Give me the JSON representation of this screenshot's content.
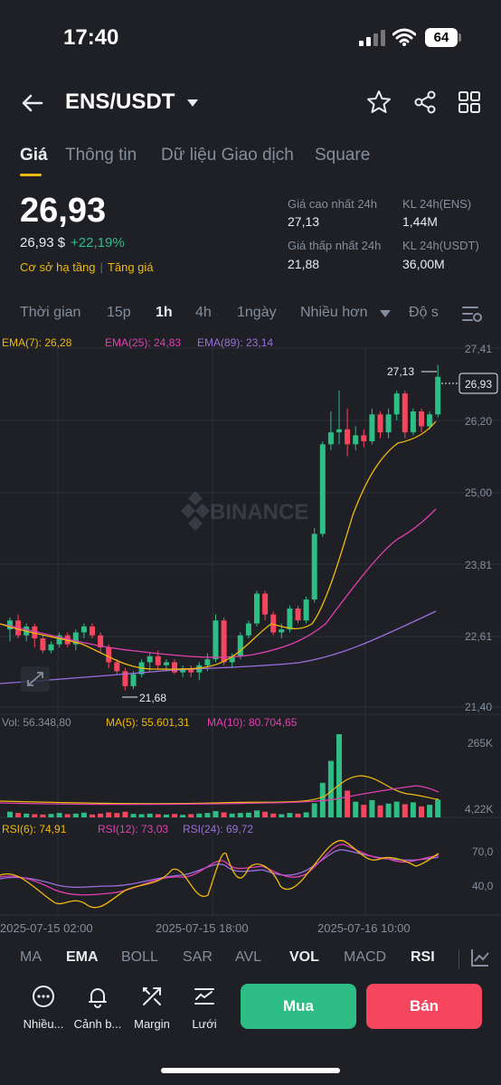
{
  "status": {
    "time": "17:40",
    "battery": "64"
  },
  "header": {
    "pair": "ENS/USDT"
  },
  "tabs": [
    {
      "label": "Giá",
      "active": true
    },
    {
      "label": "Thông tin"
    },
    {
      "label": "Dữ liệu Giao dịch"
    },
    {
      "label": "Square"
    }
  ],
  "price": {
    "last": "26,93",
    "usd": "26,93 $",
    "change": "+22,19%",
    "tag1": "Cơ sở hạ tầng",
    "tag2": "Tăng giá"
  },
  "stats": {
    "high_label": "Giá cao nhất 24h",
    "high_value": "27,13",
    "vol_ens_label": "KL 24h(ENS)",
    "vol_ens_value": "1,44M",
    "low_label": "Giá thấp nhất 24h",
    "low_value": "21,88",
    "vol_usdt_label": "KL 24h(USDT)",
    "vol_usdt_value": "36,00M"
  },
  "intervals": [
    "Thời gian",
    "15p",
    "1h",
    "4h",
    "1ngày",
    "Nhiều hơn",
    "Độ s"
  ],
  "active_interval": "1h",
  "ema_legend": {
    "ema7": "EMA(7): 26,28",
    "ema25": "EMA(25): 24,83",
    "ema89": "EMA(89): 23,14"
  },
  "price_axis": [
    "27,41",
    "26,20",
    "25,00",
    "23,81",
    "22,61",
    "21,40"
  ],
  "last_price_tag": "26,93",
  "high_marker": "27,13",
  "low_marker": "21,68",
  "watermark": "BINANCE",
  "vol_legend": {
    "vol": "Vol: 56.348,80",
    "ma5": "MA(5): 55.601,31",
    "ma10": "MA(10): 80.704,65"
  },
  "vol_axis": [
    "265K",
    "4,22K"
  ],
  "rsi_legend": {
    "rsi6": "RSI(6): 74,91",
    "rsi12": "RSI(12): 73,03",
    "rsi24": "RSI(24): 69,72"
  },
  "rsi_axis": [
    "70,0",
    "40,0"
  ],
  "time_axis": [
    "2025-07-15 02:00",
    "2025-07-15 18:00",
    "2025-07-16 10:00"
  ],
  "indicator_tabs": [
    "MA",
    "EMA",
    "BOLL",
    "SAR",
    "AVL",
    "VOL",
    "MACD",
    "RSI"
  ],
  "actions": {
    "more": "Nhiều...",
    "alert": "Cảnh b...",
    "margin": "Margin",
    "grid": "Lưới"
  },
  "buttons": {
    "buy": "Mua",
    "sell": "Bán"
  },
  "colors": {
    "up": "#2ebd85",
    "down": "#f6465d",
    "accent": "#f0b90b",
    "ema25": "#e040b0",
    "ema89": "#9b6fe0"
  },
  "chart_data": {
    "type": "candlestick",
    "ylim": [
      21.4,
      27.41
    ],
    "candles": [
      [
        22.7,
        22.85,
        22.5,
        22.9
      ],
      [
        22.85,
        22.6,
        22.55,
        22.95
      ],
      [
        22.6,
        22.75,
        22.5,
        22.8
      ],
      [
        22.75,
        22.55,
        22.4,
        22.8
      ],
      [
        22.55,
        22.35,
        22.3,
        22.6
      ],
      [
        22.35,
        22.45,
        22.3,
        22.5
      ],
      [
        22.45,
        22.6,
        22.4,
        22.65
      ],
      [
        22.6,
        22.45,
        22.4,
        22.65
      ],
      [
        22.45,
        22.65,
        22.35,
        22.7
      ],
      [
        22.65,
        22.75,
        22.55,
        22.8
      ],
      [
        22.75,
        22.6,
        22.55,
        22.8
      ],
      [
        22.6,
        22.4,
        22.3,
        22.65
      ],
      [
        22.4,
        22.15,
        22.05,
        22.45
      ],
      [
        22.15,
        22.0,
        21.95,
        22.2
      ],
      [
        22.0,
        21.75,
        21.68,
        22.05
      ],
      [
        21.75,
        21.95,
        21.7,
        22.0
      ],
      [
        21.95,
        22.15,
        21.9,
        22.2
      ],
      [
        22.15,
        22.25,
        22.0,
        22.3
      ],
      [
        22.25,
        22.1,
        22.05,
        22.35
      ],
      [
        22.1,
        22.15,
        22.0,
        22.2
      ],
      [
        22.15,
        21.98,
        21.95,
        22.2
      ],
      [
        21.98,
        22.05,
        21.9,
        22.1
      ],
      [
        22.05,
        21.98,
        21.9,
        22.1
      ],
      [
        21.98,
        22.1,
        21.85,
        22.15
      ],
      [
        22.1,
        22.2,
        22.0,
        22.3
      ],
      [
        22.2,
        22.85,
        22.15,
        22.95
      ],
      [
        22.85,
        22.15,
        22.1,
        22.9
      ],
      [
        22.15,
        22.25,
        22.05,
        22.3
      ],
      [
        22.25,
        22.6,
        22.2,
        22.65
      ],
      [
        22.6,
        22.8,
        22.55,
        22.85
      ],
      [
        22.8,
        23.3,
        22.75,
        23.35
      ],
      [
        23.3,
        22.95,
        22.85,
        23.35
      ],
      [
        22.95,
        22.65,
        22.6,
        23.0
      ],
      [
        22.65,
        22.7,
        22.55,
        22.8
      ],
      [
        22.7,
        23.05,
        22.65,
        23.1
      ],
      [
        23.05,
        22.85,
        22.8,
        23.1
      ],
      [
        22.85,
        23.2,
        22.8,
        23.25
      ],
      [
        23.2,
        24.3,
        23.15,
        24.4
      ],
      [
        24.3,
        25.8,
        24.25,
        25.85
      ],
      [
        25.8,
        26.0,
        25.7,
        26.35
      ],
      [
        26.0,
        26.05,
        25.8,
        26.7
      ],
      [
        26.05,
        25.8,
        25.6,
        26.4
      ],
      [
        25.8,
        25.95,
        25.7,
        26.1
      ],
      [
        25.95,
        25.85,
        25.75,
        26.05
      ],
      [
        25.85,
        26.3,
        25.8,
        26.4
      ],
      [
        26.3,
        26.0,
        25.9,
        26.35
      ],
      [
        26.0,
        26.3,
        25.9,
        26.4
      ],
      [
        26.3,
        26.65,
        26.2,
        26.7
      ],
      [
        26.65,
        26.0,
        25.9,
        26.7
      ],
      [
        26.0,
        26.35,
        25.95,
        26.4
      ],
      [
        26.35,
        26.1,
        26.0,
        26.4
      ],
      [
        26.1,
        26.3,
        26.05,
        26.35
      ],
      [
        26.3,
        26.93,
        26.25,
        27.13
      ]
    ],
    "volume_ylim": [
      0,
      265000
    ],
    "volumes": [
      18,
      14,
      12,
      10,
      9,
      11,
      14,
      10,
      12,
      15,
      9,
      12,
      16,
      14,
      18,
      11,
      10,
      12,
      10,
      9,
      11,
      8,
      10,
      12,
      14,
      20,
      16,
      12,
      14,
      15,
      22,
      18,
      12,
      10,
      14,
      12,
      16,
      45,
      110,
      180,
      265,
      85,
      50,
      40,
      55,
      38,
      44,
      50,
      42,
      48,
      35,
      40,
      56.3
    ]
  }
}
